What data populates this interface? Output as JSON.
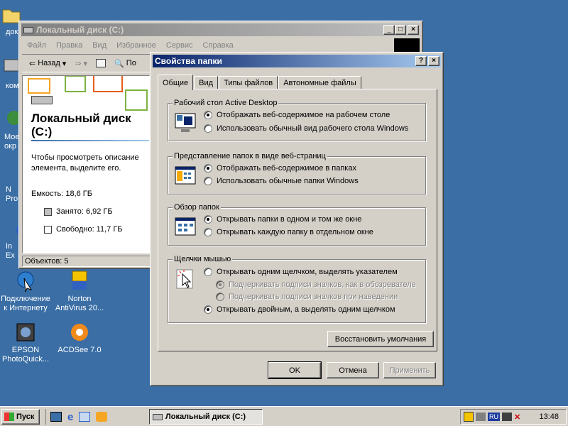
{
  "desktop": {
    "icons": [
      {
        "label": "док"
      },
      {
        "label": "ком"
      },
      {
        "label": "Мое\nокр"
      },
      {
        "label": "N\nPro"
      },
      {
        "label": "In\nEx"
      },
      {
        "label": "Подключение\nк Интернету"
      },
      {
        "label": "Norton\nAntiVirus 20..."
      },
      {
        "label": "EPSON\nPhotoQuick..."
      },
      {
        "label": "ACDSee 7.0"
      }
    ]
  },
  "explorer": {
    "title": "Локальный диск (C:)",
    "menu": [
      "Файл",
      "Правка",
      "Вид",
      "Избранное",
      "Сервис",
      "Справка"
    ],
    "toolbar": {
      "back": "Назад",
      "partial": "По"
    },
    "content": {
      "heading": "Локальный диск\n(C:)",
      "hint": "Чтобы просмотреть описание элемента, выделите его.",
      "capacity": "Емкость: 18,6 ГБ",
      "used": "Занято: 6,92 ГБ",
      "free": "Свободно: 11,7 ГБ"
    },
    "status": "Объектов: 5"
  },
  "dialog": {
    "title": "Свойства папки",
    "tabs": [
      "Общие",
      "Вид",
      "Типы файлов",
      "Автономные файлы"
    ],
    "groups": {
      "desktop": {
        "title": "Рабочий стол Active Desktop",
        "opt1": "Отображать веб-содержимое на рабочем столе",
        "opt2": "Использовать обычный вид рабочего стола Windows"
      },
      "webview": {
        "title": "Представление папок в виде веб-страниц",
        "opt1": "Отображать веб-содержимое в папках",
        "opt2": "Использовать обычные папки Windows"
      },
      "browse": {
        "title": "Обзор папок",
        "opt1": "Открывать папки в одном и том же окне",
        "opt2": "Открывать каждую папку в отдельном окне"
      },
      "click": {
        "title": "Щелчки мышью",
        "opt1": "Открывать одним щелчком, выделять указателем",
        "sub1": "Подчеркивать подписи значков, как в обозревателе",
        "sub2": "Подчеркивать подписи значков при наведении",
        "opt2": "Открывать двойным, а выделять одним щелчком"
      }
    },
    "restore_defaults": "Восстановить умолчания",
    "ok": "OK",
    "cancel": "Отмена",
    "apply": "Применить"
  },
  "taskbar": {
    "start": "Пуск",
    "task": "Локальный диск (C:)",
    "lang": "RU",
    "clock": "13:48"
  }
}
